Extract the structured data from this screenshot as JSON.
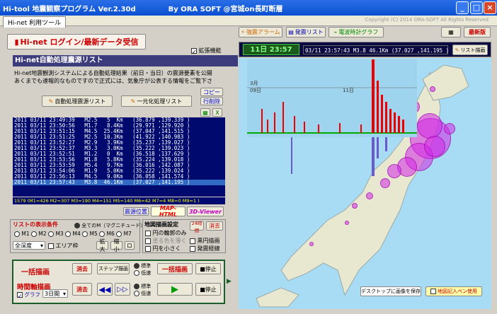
{
  "window": {
    "title": "Hi-tool 地震観察プログラム Ver.2.30d",
    "author": "By ORA SOFT @宮城on長町断層",
    "copyright": "Copyright (C) 2014 ORA-SOFT All Rights Reserved"
  },
  "tab": "Hi-net 利用ツール",
  "login_button": "Hi-net ログイン/最新データ受信",
  "extend_label": "拡張機能",
  "section_title": "Hi-net自動処理震源リスト",
  "desc1": "Hi-net地震観測システムによる自動処理結果（前日・当日）の震源要素を公開",
  "desc2": "あくまでも速報的なものですので正式には、気象庁が公表する情報をご覧下さ",
  "auto_list_btn": "自動処理震源リスト",
  "unified_list_btn": "一元化処理リスト",
  "copy_btn": "コピー",
  "line_count_btn": "行削除",
  "list_rows": [
    "2011 03/11 23:49:39   M2.5   5  Km   (36.879 ,139.339 )",
    "2011 03/11 23:50:56   M1.7   8.4Km   (29.971 ,129.920 )",
    "2011 03/11 23:51:15   M4.5  25.4Km   (37.047 ,141.515 )",
    "2011 03/11 23:51:25   M2.5  10.3Km   (41.922 ,140.983 )",
    "2011 03/11 23:52:27   M2.9   3.9Km   (35.237 ,139.027 )",
    "2011 03/11 23:52:37   M3.3   3.0Km   (35.222 ,139.023 )",
    "2011 03/11 23:52:51   M1.2   0  Km   (36.518 ,137.629 )",
    "2011 03/11 23:53:56   M1.8   5.8Km   (35.224 ,139.018 )",
    "2011 03/11 23:53:59   M5.4   9.7Km   (36.016 ,142.087 )",
    "2011 03/11 23:54:06   M1.9   5.0Km   (35.222 ,139.024 )",
    "2011 03/11 23:56:13   M4.5   9.0Km   (36.058 ,141.574 )",
    "2011 03/11 23:57:43   M3.8  46.1Km   (37.027 ,141.195 )"
  ],
  "stats": "1579 (M1=426  M2=307  M3=190  M4=151  M5=140  M6=42  M7=4  M8=0  M9=1 )",
  "source_btn": "震源位置",
  "map_html_btn": "MAP-HTML",
  "viewer_btn": "3D-Viewer",
  "cond_title": "リストの表示条件",
  "all_m": "全てのM（マグニチュード）",
  "mags": [
    "M1",
    "M2",
    "M3",
    "M4",
    "M5",
    "M6",
    "M7"
  ],
  "region": "全深度",
  "area_label": "エリア枠",
  "zoom_in": "拡大",
  "zoom_out": "縮小",
  "zoom_reset": "ロ",
  "draw_settings": "地図描画設定",
  "d_opts": [
    "円の輪郭のみ",
    "塗る色を薄く",
    "円を小さく"
  ],
  "d_opts2": [
    "黒円描画",
    "発震経線"
  ],
  "yr_btn": "24時間",
  "clear": "消去",
  "bulk_draw": "一括描画",
  "step_draw": "ステップ描画",
  "speed_std": "標準",
  "speed_low": "低速",
  "stop": "■停止",
  "time_axis": "時間軸描画",
  "graph": "グラフ",
  "days": "3日間",
  "toolbar": {
    "eq_alarm": "強震アラーム",
    "eq_list": "発震リスト",
    "tsunami": "電波時計グラフ",
    "version": "最新版",
    "list_draw": "リスト描画"
  },
  "header_time": "11日 23:57",
  "header_info": "03/11 23:57:43  M3.8  46.1Km  (37.027 ,141.195 )",
  "chart_month": "3月",
  "chart_day1": "09日",
  "chart_day2": "11日",
  "desktop_btn": "デスクトップに画像を保存",
  "map_pen": "地図記入ペン使用",
  "colors": {
    "accent": "#0a4fd0",
    "map_bg": "#a8dcf4",
    "quake": "#d028e6"
  }
}
